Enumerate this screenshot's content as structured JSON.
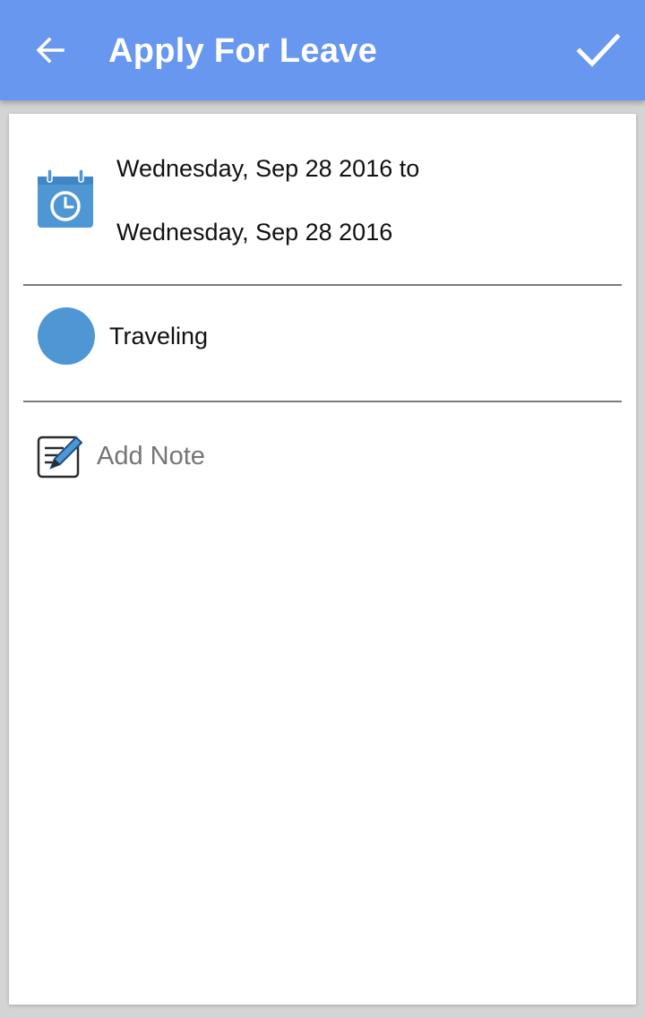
{
  "header": {
    "title": "Apply For Leave",
    "back_icon": "arrow-back-icon",
    "confirm_icon": "checkmark-icon",
    "background_color": "#6897f0"
  },
  "leave": {
    "date_from": "Wednesday, Sep 28 2016 to",
    "date_to": "Wednesday, Sep 28 2016",
    "date_icon": "calendar-clock-icon",
    "type_label": "Traveling",
    "type_color": "#4f96d4",
    "note_icon": "edit-note-icon",
    "note_placeholder": "Add Note",
    "note_value": ""
  }
}
